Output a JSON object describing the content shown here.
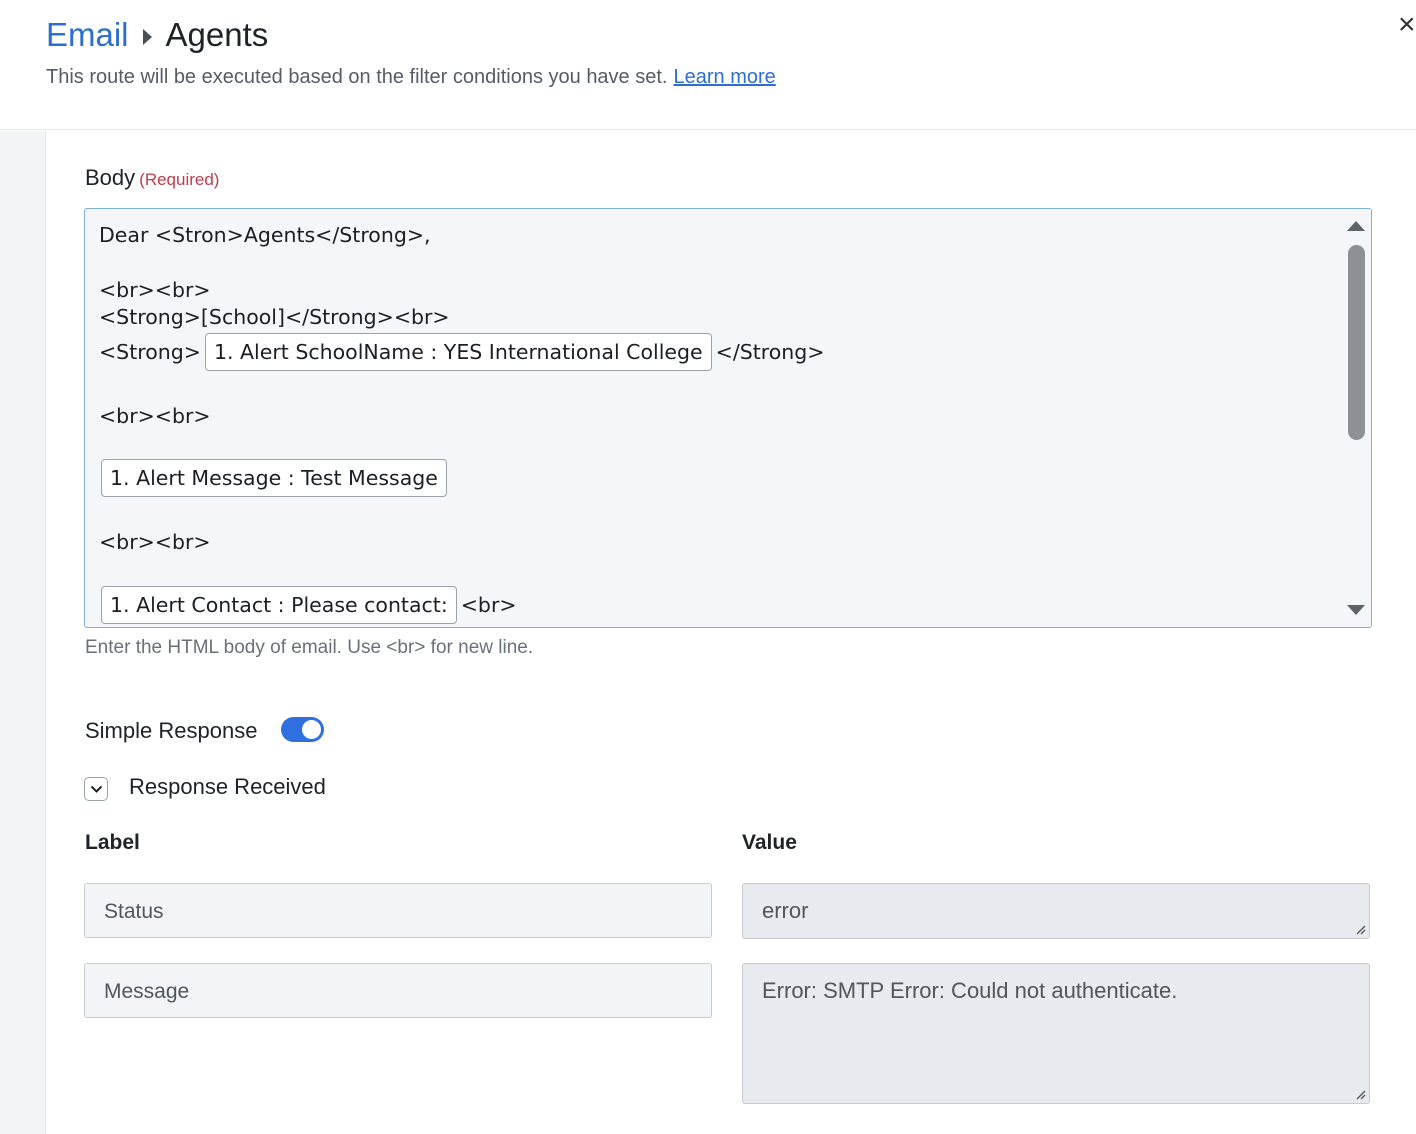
{
  "header": {
    "breadcrumb_app": "Email",
    "breadcrumb_current": "Agents",
    "subtitle": "This route will be executed based on the filter conditions you have set.",
    "learn_more": "Learn more",
    "close_icon": "×"
  },
  "body_field": {
    "label": "Body",
    "required": "(Required)",
    "hint": "Enter the HTML body of email. Use <br> for new line.",
    "lines": {
      "l1": "Dear <Stron>Agents</Strong>,",
      "l2": "<br><br>",
      "l3": "<Strong>[School]</Strong><br>",
      "l4_pre": "<Strong>",
      "l4_chip": "1. Alert SchoolName : YES International College",
      "l4_post": "</Strong>",
      "l5": "<br><br>",
      "l6_chip": "1. Alert Message : Test Message",
      "l7": "<br><br>",
      "l8_chip": "1. Alert Contact : Please contact:",
      "l8_post": "<br>"
    }
  },
  "simple_response": {
    "label": "Simple Response",
    "enabled": true
  },
  "response_received": {
    "label": "Response Received",
    "col_label": "Label",
    "col_value": "Value",
    "rows": [
      {
        "label": "Status",
        "value": "error"
      },
      {
        "label": "Message",
        "value": "Error: SMTP Error: Could not authenticate."
      }
    ]
  },
  "colors": {
    "accent": "#2f6fe0",
    "link": "#2d6fcf",
    "required": "#c23a4b"
  }
}
